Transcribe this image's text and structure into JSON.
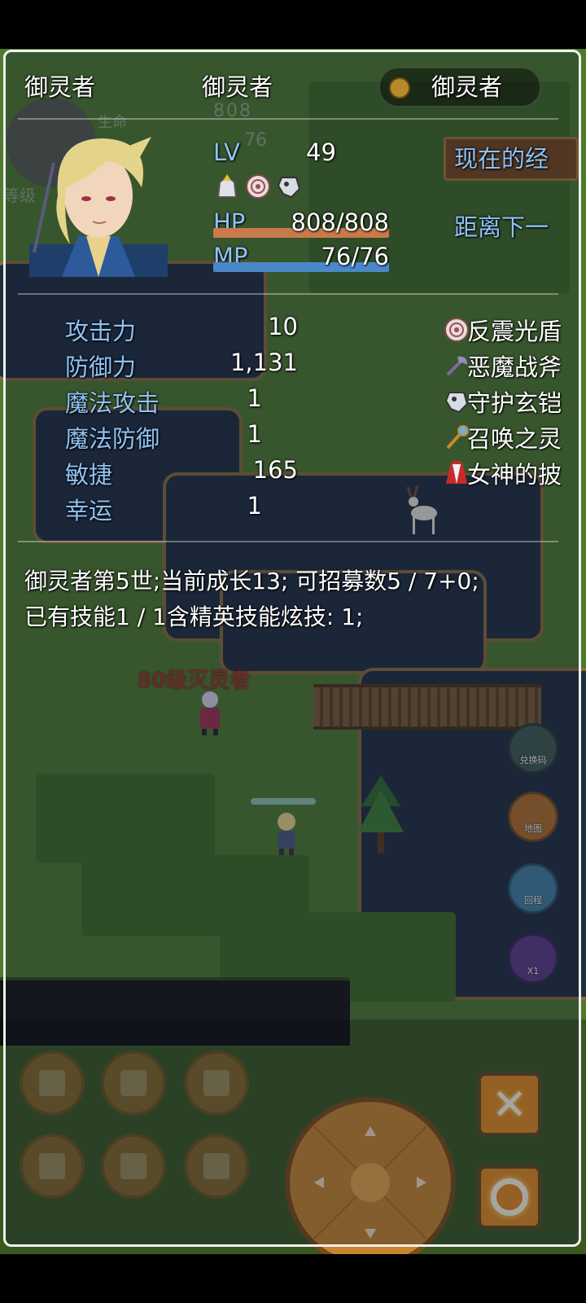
{
  "header": {
    "col1_name": "御灵者",
    "col2_class": "御灵者",
    "col3_title": "御灵者"
  },
  "character": {
    "lv_label": "LV",
    "lv_value": "49",
    "hp_label": "HP",
    "hp_value": "808/808",
    "hp_fraction": 1.0,
    "mp_label": "MP",
    "mp_value": "76/76",
    "mp_fraction": 1.0,
    "state_icons": [
      "knight-helm-icon",
      "target-shield-icon",
      "guardian-icon"
    ]
  },
  "exp": {
    "current_label": "现在的经",
    "next_label": "距离下一"
  },
  "stats": [
    {
      "label": "攻击力",
      "value": "10"
    },
    {
      "label": "防御力",
      "value": "1,131"
    },
    {
      "label": "魔法攻击",
      "value": "1"
    },
    {
      "label": "魔法防御",
      "value": "1"
    },
    {
      "label": "敏捷",
      "value": "165"
    },
    {
      "label": "幸运",
      "value": "1"
    }
  ],
  "equipment": [
    {
      "icon": "shield-icon",
      "name": "反震光盾"
    },
    {
      "icon": "axe-icon",
      "name": "恶魔战斧"
    },
    {
      "icon": "armor-icon",
      "name": "守护玄铠"
    },
    {
      "icon": "staff-icon",
      "name": "召唤之灵"
    },
    {
      "icon": "cape-icon",
      "name": "女神的披"
    }
  ],
  "description": {
    "line1": "御灵者第5世;当前成长13;  可招募数5 / 7+0;",
    "line2": "已有技能1 / 1含精英技能炫技:  1;"
  },
  "background": {
    "bg_hp_value": "808",
    "bg_mp_value": "76",
    "bg_life_label": "生命",
    "bg_level_label": "等级",
    "enemy_label": "80级灭灵者"
  },
  "side_buttons": [
    {
      "label": "兑换码",
      "icon": "code-icon",
      "color": "#3e5a52"
    },
    {
      "label": "地图",
      "icon": "map-icon",
      "color": "#b06c2a"
    },
    {
      "label": "回程",
      "icon": "return-icon",
      "color": "#3f7f9f"
    },
    {
      "label": "X1",
      "icon": "speed-icon",
      "color": "#5a3a86"
    }
  ],
  "menu_buttons": [
    "rank-icon",
    "skill-icon",
    "item-icon",
    "hand-icon",
    "pet-icon",
    "gift-icon"
  ],
  "controls": {
    "cancel_symbol": "✕",
    "confirm_symbol": "◯"
  },
  "colors": {
    "hp_gauge": "#c87a4a",
    "mp_gauge": "#4a88c8",
    "system_text": "#8ec2f5"
  }
}
